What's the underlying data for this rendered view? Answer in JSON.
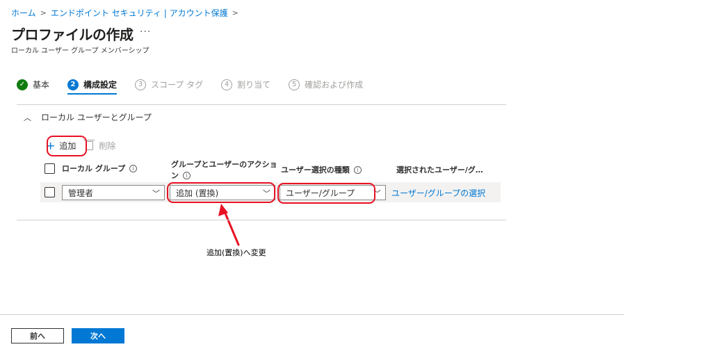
{
  "breadcrumb": {
    "home": "ホーム",
    "parent": "エンドポイント セキュリティ | アカウント保護"
  },
  "page": {
    "title": "プロファイルの作成",
    "more": "···",
    "subtitle": "ローカル ユーザー グループ メンバーシップ"
  },
  "steps": [
    {
      "number": "✓",
      "label": "基本",
      "state": "done"
    },
    {
      "number": "2",
      "label": "構成設定",
      "state": "active"
    },
    {
      "number": "3",
      "label": "スコープ タグ",
      "state": "pending"
    },
    {
      "number": "4",
      "label": "割り当て",
      "state": "pending"
    },
    {
      "number": "5",
      "label": "確認および作成",
      "state": "pending"
    }
  ],
  "section": {
    "title": "ローカル ユーザーとグループ"
  },
  "toolbar": {
    "add_label": "追加",
    "delete_label": "削除"
  },
  "table": {
    "headers": {
      "local_group": "ローカル グループ",
      "action_line1": "グループとユーザーのアクショ",
      "action_line2": "ン",
      "selection_type": "ユーザー選択の種類",
      "selected": "選択されたユーザー/グ…"
    },
    "row": {
      "local_group": "管理者",
      "action": "追加 (置換)",
      "selection_type": "ユーザー/グループ",
      "select_link": "ユーザー/グループの選択"
    }
  },
  "annotation": {
    "text": "追加(置換)へ変更",
    "color": "#e81123"
  },
  "footer": {
    "prev": "前へ",
    "next": "次へ"
  },
  "colors": {
    "accent": "#0078d4",
    "success": "#107c10",
    "highlight": "#e81123"
  }
}
